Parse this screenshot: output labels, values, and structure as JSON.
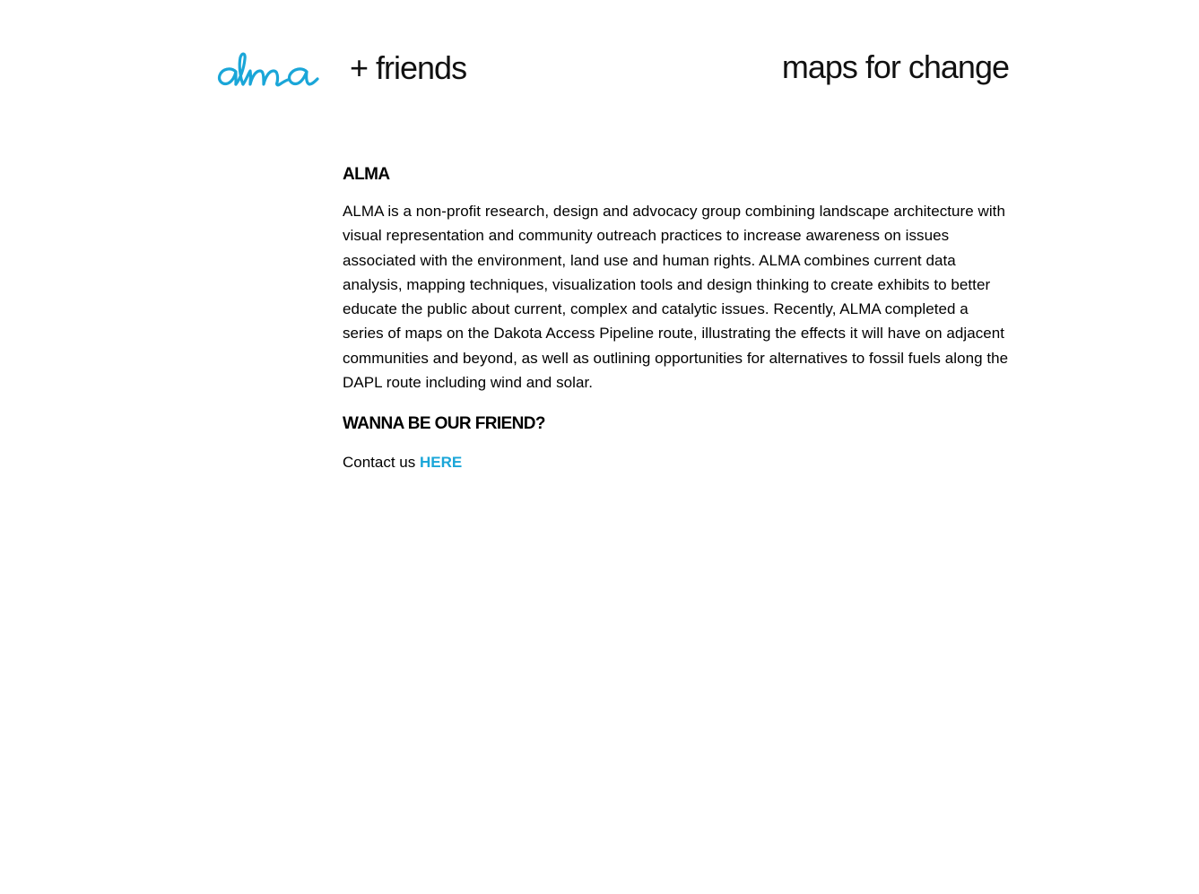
{
  "header": {
    "logo_friends": "+ friends",
    "tagline": "maps for change",
    "brand_color": "#1aa6d8"
  },
  "about": {
    "heading": "ALMA",
    "body": "ALMA is a non-profit research, design and advocacy group combining landscape architecture with visual representation and community outreach practices to increase awareness on issues associated with the environment, land use and human rights. ALMA combines current data analysis, mapping techniques, visualization tools and design thinking to create exhibits to better educate the public about current, complex and catalytic issues. Recently, ALMA completed a series of maps on the Dakota Access Pipeline route, illustrating the effects it will have on adjacent communities and beyond, as well as outlining opportunities for alternatives to fossil fuels along the DAPL route including wind and solar."
  },
  "friend": {
    "heading": "WANNA BE OUR FRIEND?",
    "contact_prefix": "Contact us",
    "contact_link": "HERE"
  }
}
